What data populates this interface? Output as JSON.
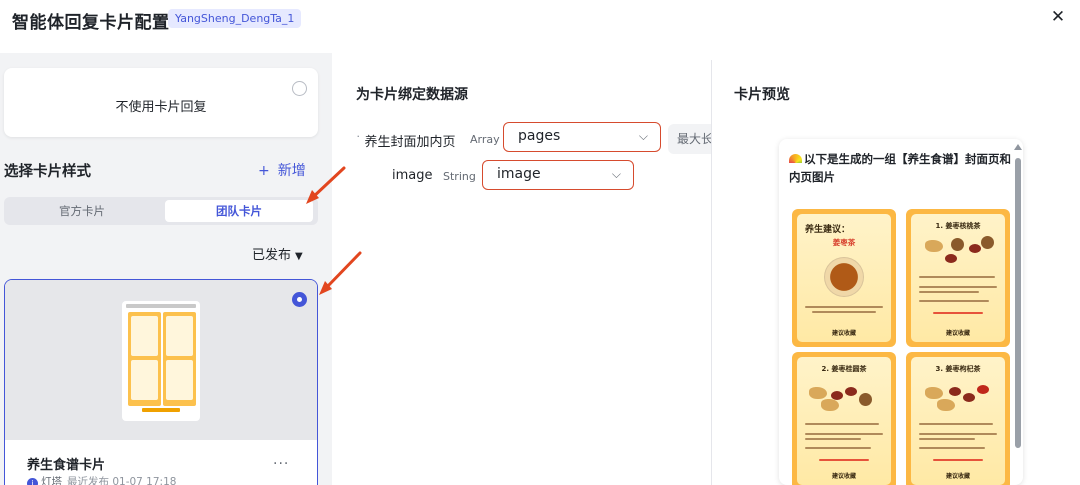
{
  "header": {
    "title": "智能体回复卡片配置",
    "agent_tag": "YangSheng_DengTa_1",
    "close_icon": "close-icon"
  },
  "left_panel": {
    "no_card_option": "不使用卡片回复",
    "section_title": "选择卡片样式",
    "add_button": "新增",
    "tabs": [
      {
        "label": "官方卡片",
        "selected": false
      },
      {
        "label": "团队卡片",
        "selected": true
      }
    ],
    "status_filter": "已发布",
    "card": {
      "name": "养生食谱卡片",
      "owner": "灯塔",
      "published": "最近发布 01-07 17:18",
      "selected": true
    }
  },
  "binding": {
    "title": "为卡片绑定数据源",
    "fields": [
      {
        "label": "养生封面加内页",
        "type": "Array",
        "value": "pages",
        "extra": "最大长"
      },
      {
        "label": "image",
        "type": "String",
        "value": "image"
      }
    ]
  },
  "preview": {
    "title": "卡片预览",
    "message": "以下是生成的一组【养生食谱】封面页和内页图片",
    "posters": [
      {
        "title": "养生建议：",
        "subtitle": "姜枣茶",
        "footer": "建议收藏"
      },
      {
        "title": "1. 姜枣核桃茶",
        "footer": "建议收藏"
      },
      {
        "title": "2. 姜枣桂圆茶",
        "footer": "建议收藏"
      },
      {
        "title": "3. 姜枣枸杞茶",
        "footer": "建议收藏"
      }
    ]
  },
  "colors": {
    "accent": "#4456d8",
    "highlight_border": "#d64b2e",
    "poster": "#fcb844"
  }
}
